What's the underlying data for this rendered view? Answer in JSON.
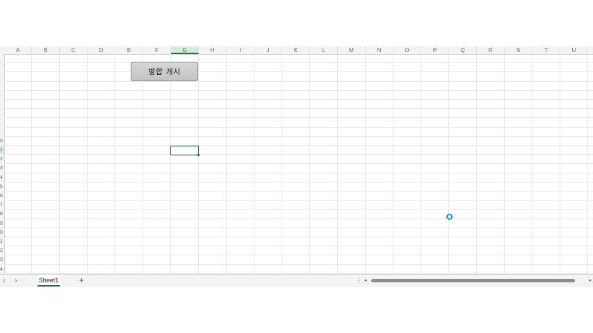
{
  "columns": [
    "A",
    "B",
    "C",
    "D",
    "E",
    "F",
    "G",
    "H",
    "I",
    "J",
    "K",
    "L",
    "M",
    "N",
    "O",
    "P",
    "Q",
    "R",
    "S",
    "T",
    "U"
  ],
  "selected_column": "G",
  "rows": [
    "",
    "",
    "",
    "",
    "",
    "",
    "",
    "",
    "",
    "0",
    "1",
    "2",
    "3",
    "4",
    "5",
    "6",
    "7",
    "8",
    "9",
    "0",
    "1",
    "2",
    "3",
    "4"
  ],
  "selected_row": "1",
  "button": {
    "label": "병합 개시"
  },
  "tabs": {
    "sheet_name": "Sheet1",
    "add_label": "+",
    "prev": "‹",
    "next": "›",
    "split": "⋮"
  },
  "scrollbar": {
    "left": "◂",
    "right": "▸"
  },
  "colors": {
    "accent": "#217346",
    "cursor": "#1e90d6",
    "button_bg": "#c9c9c9"
  },
  "icons": {
    "busy": "busy-cursor-icon",
    "prev": "chevron-left-icon",
    "next": "chevron-right-icon",
    "add": "plus-icon"
  }
}
